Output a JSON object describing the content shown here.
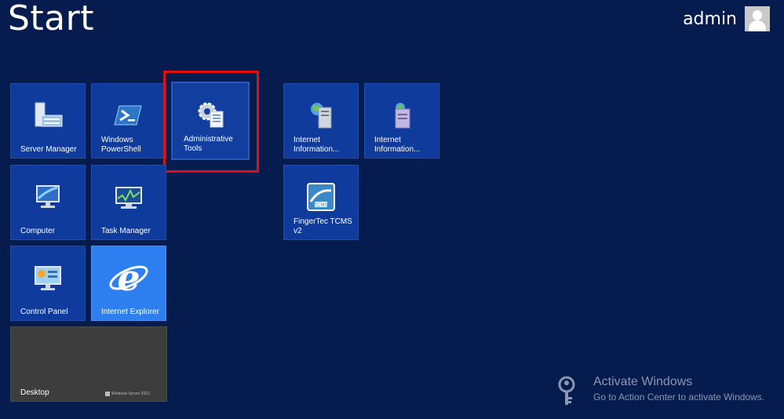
{
  "header": {
    "title": "Start",
    "user_name": "admin"
  },
  "tiles": {
    "server_manager": "Server Manager",
    "powershell": "Windows PowerShell",
    "admin_tools": "Administrative Tools",
    "iis1": "Internet Information...",
    "iis2": "Internet Information...",
    "computer": "Computer",
    "task_manager": "Task Manager",
    "fingertec": "FingerTec TCMS v2",
    "control_panel": "Control Panel",
    "internet_explorer": "Internet Explorer",
    "desktop": "Desktop"
  },
  "desktop_logo_text": "Windows Server 2012",
  "watermark": {
    "title": "Activate Windows",
    "subtitle": "Go to Action Center to activate Windows."
  },
  "colors": {
    "background": "#061b4e",
    "tile": "#0f3b9c",
    "ie_tile": "#2d7ff0",
    "desktop_tile": "#3d3d3d",
    "highlight": "#e01010"
  }
}
